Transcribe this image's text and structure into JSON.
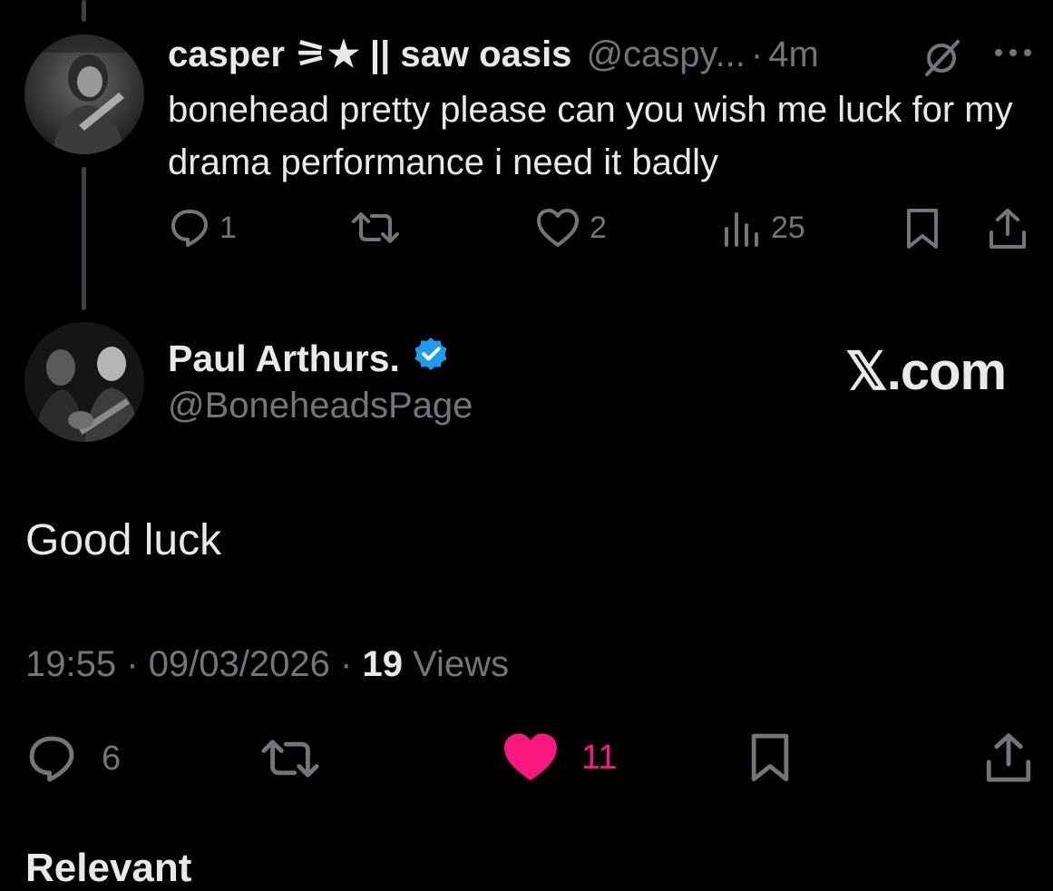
{
  "reply_tweet": {
    "display_name": "casper ⚞★ || saw oasis",
    "handle": "@caspy...",
    "separator": "·",
    "time": "4m",
    "text": "bonehead pretty please can you wish me luck for my drama performance i need it badly",
    "icons": {
      "avatar": "avatar",
      "grok": "grok-icon",
      "more": "more-icon"
    },
    "actions": {
      "replies": "1",
      "reposts": "",
      "likes": "2",
      "views": "25"
    }
  },
  "main_tweet": {
    "display_name": "Paul Arthurs.",
    "verified": true,
    "handle": "@BoneheadsPage",
    "watermark": "𝕏.com",
    "text": "Good luck",
    "meta": {
      "time": "19:55",
      "separator": "·",
      "date": "09/03/2026",
      "views_count": "19",
      "views_label": "Views"
    },
    "actions": {
      "replies": "6",
      "reposts": "",
      "likes": "11",
      "liked": true
    }
  },
  "next_section": {
    "label": "Relevant"
  },
  "colors": {
    "background": "#000000",
    "text_primary": "#e7e9ea",
    "text_secondary": "#71767b",
    "verified_blue": "#1d9bf0",
    "like_pink": "#f91880",
    "thread_line": "#3e4144"
  }
}
